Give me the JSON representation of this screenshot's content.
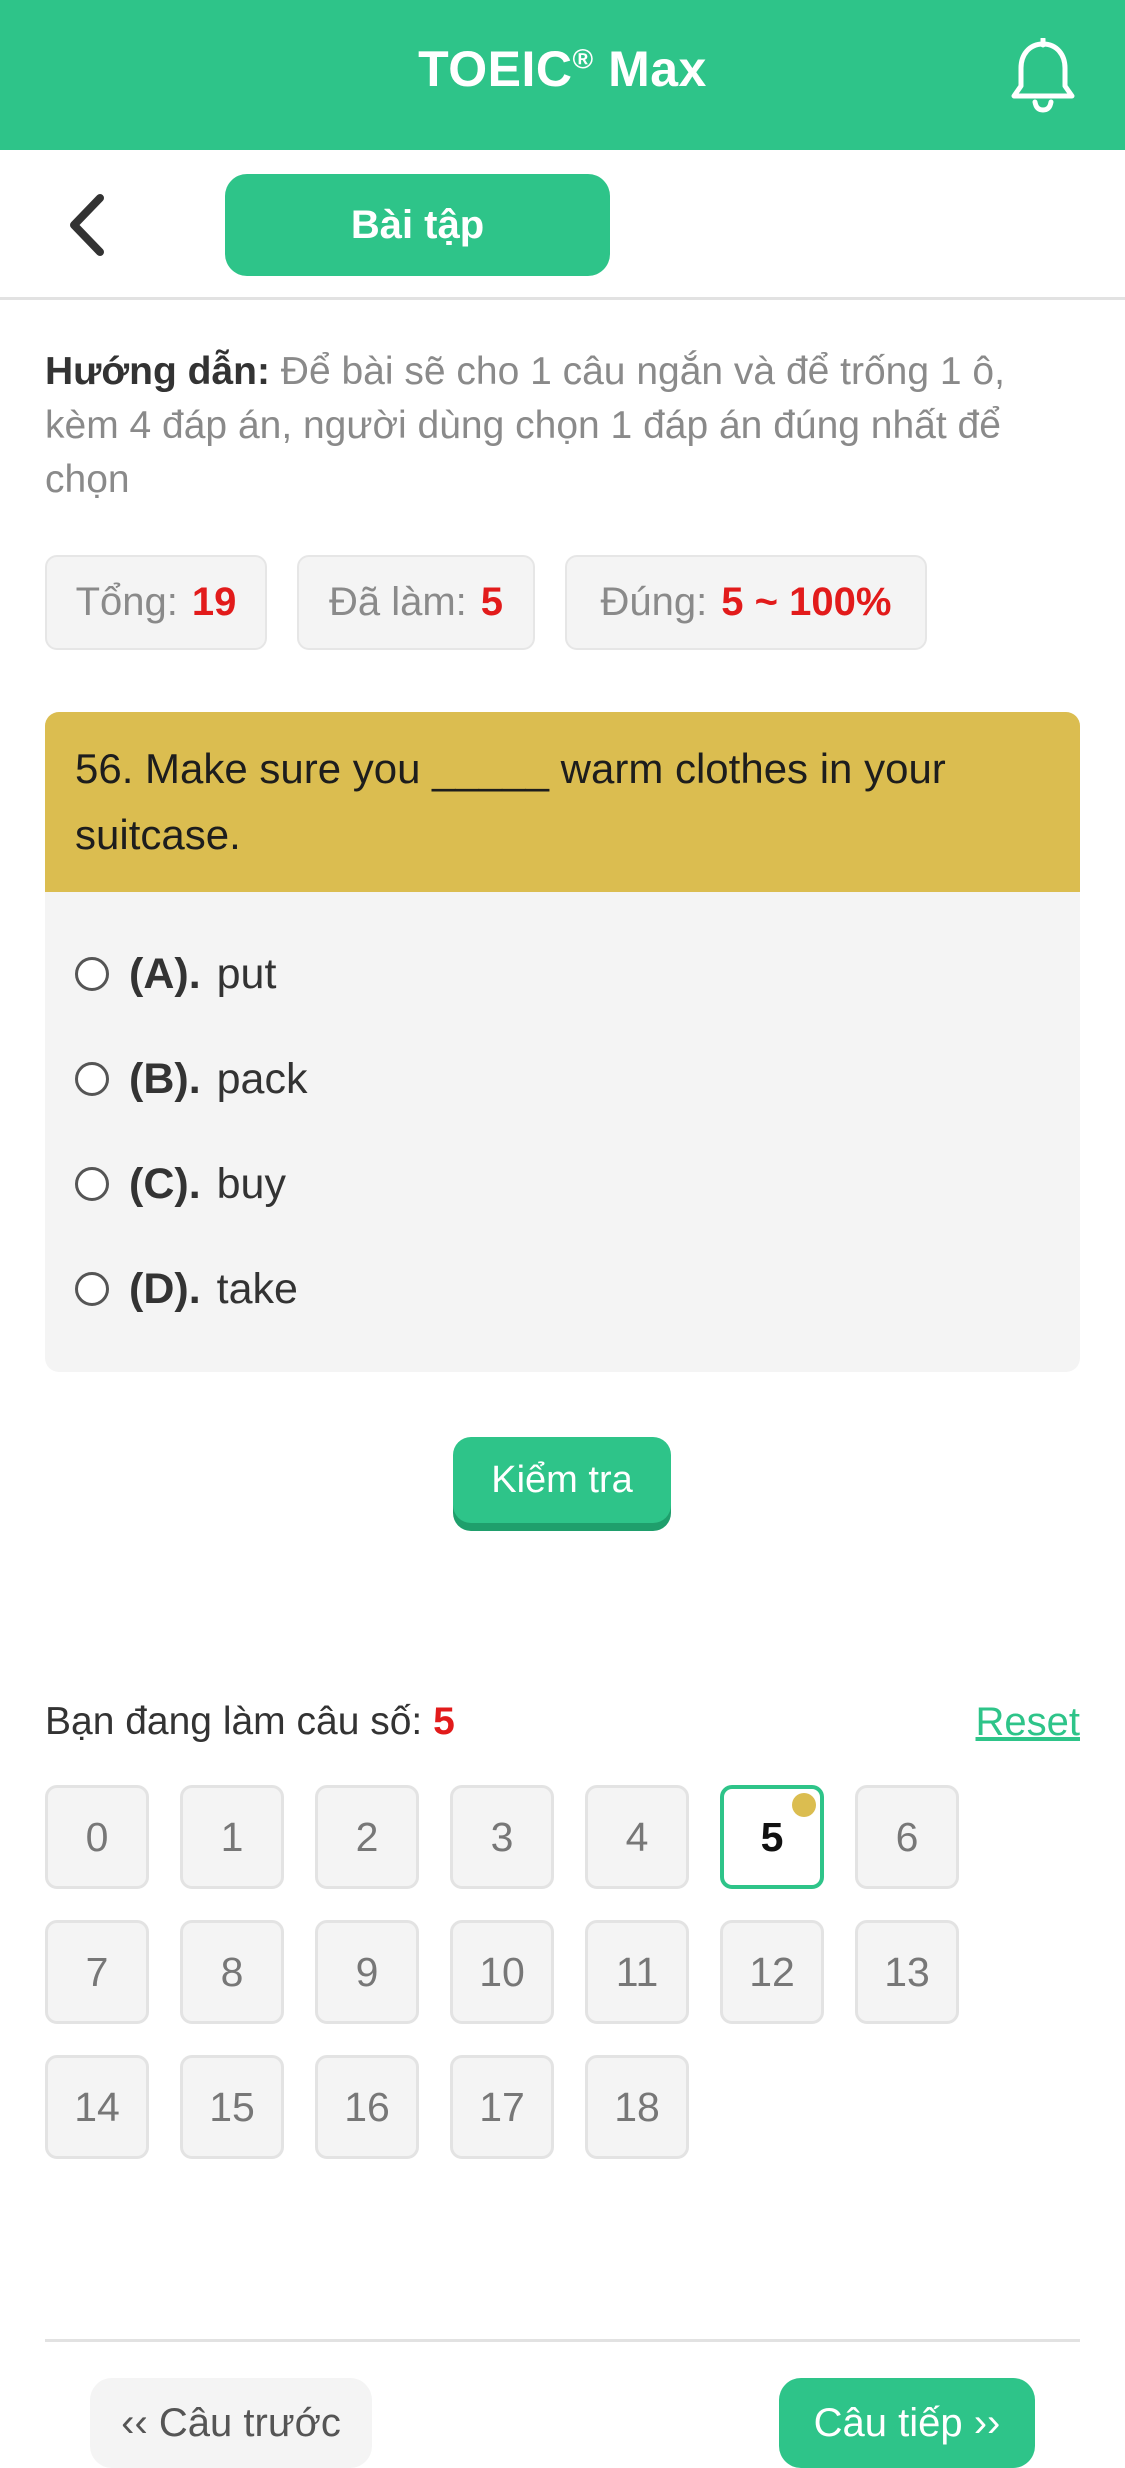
{
  "header": {
    "title": "TOEIC",
    "title_mark": "®",
    "title_suffix": "Max"
  },
  "subheader": {
    "tab_label": "Bài tập"
  },
  "instructions": {
    "label": "Hướng dẫn:",
    "text": "Để bài sẽ cho 1 câu ngắn và để trống 1 ô, kèm 4 đáp án, người dùng chọn 1 đáp án đúng nhất để chọn"
  },
  "stats": {
    "total_label": "Tổng:",
    "total_value": "19",
    "done_label": "Đã làm:",
    "done_value": "5",
    "correct_label": "Đúng:",
    "correct_value": "5 ~ 100%"
  },
  "question": {
    "text": "56. Make sure you _____ warm clothes in your suitcase.",
    "options": [
      {
        "letter": "(A).",
        "text": "put"
      },
      {
        "letter": "(B).",
        "text": "pack"
      },
      {
        "letter": "(C).",
        "text": "buy"
      },
      {
        "letter": "(D).",
        "text": "take"
      }
    ]
  },
  "check_button": "Kiểm tra",
  "progress": {
    "label": "Bạn đang làm câu số:",
    "current": "5",
    "reset": "Reset",
    "numbers": [
      "0",
      "1",
      "2",
      "3",
      "4",
      "5",
      "6",
      "7",
      "8",
      "9",
      "10",
      "11",
      "12",
      "13",
      "14",
      "15",
      "16",
      "17",
      "18"
    ]
  },
  "nav": {
    "prev": "‹‹ Câu trước",
    "next": "Câu tiếp ››"
  },
  "colors": {
    "brand_green": "#2ec489",
    "question_header": "#dbbd50",
    "accent_red": "#e21b1b"
  },
  "icons": {
    "bell": "bell-icon",
    "back": "chevron-left-icon"
  }
}
